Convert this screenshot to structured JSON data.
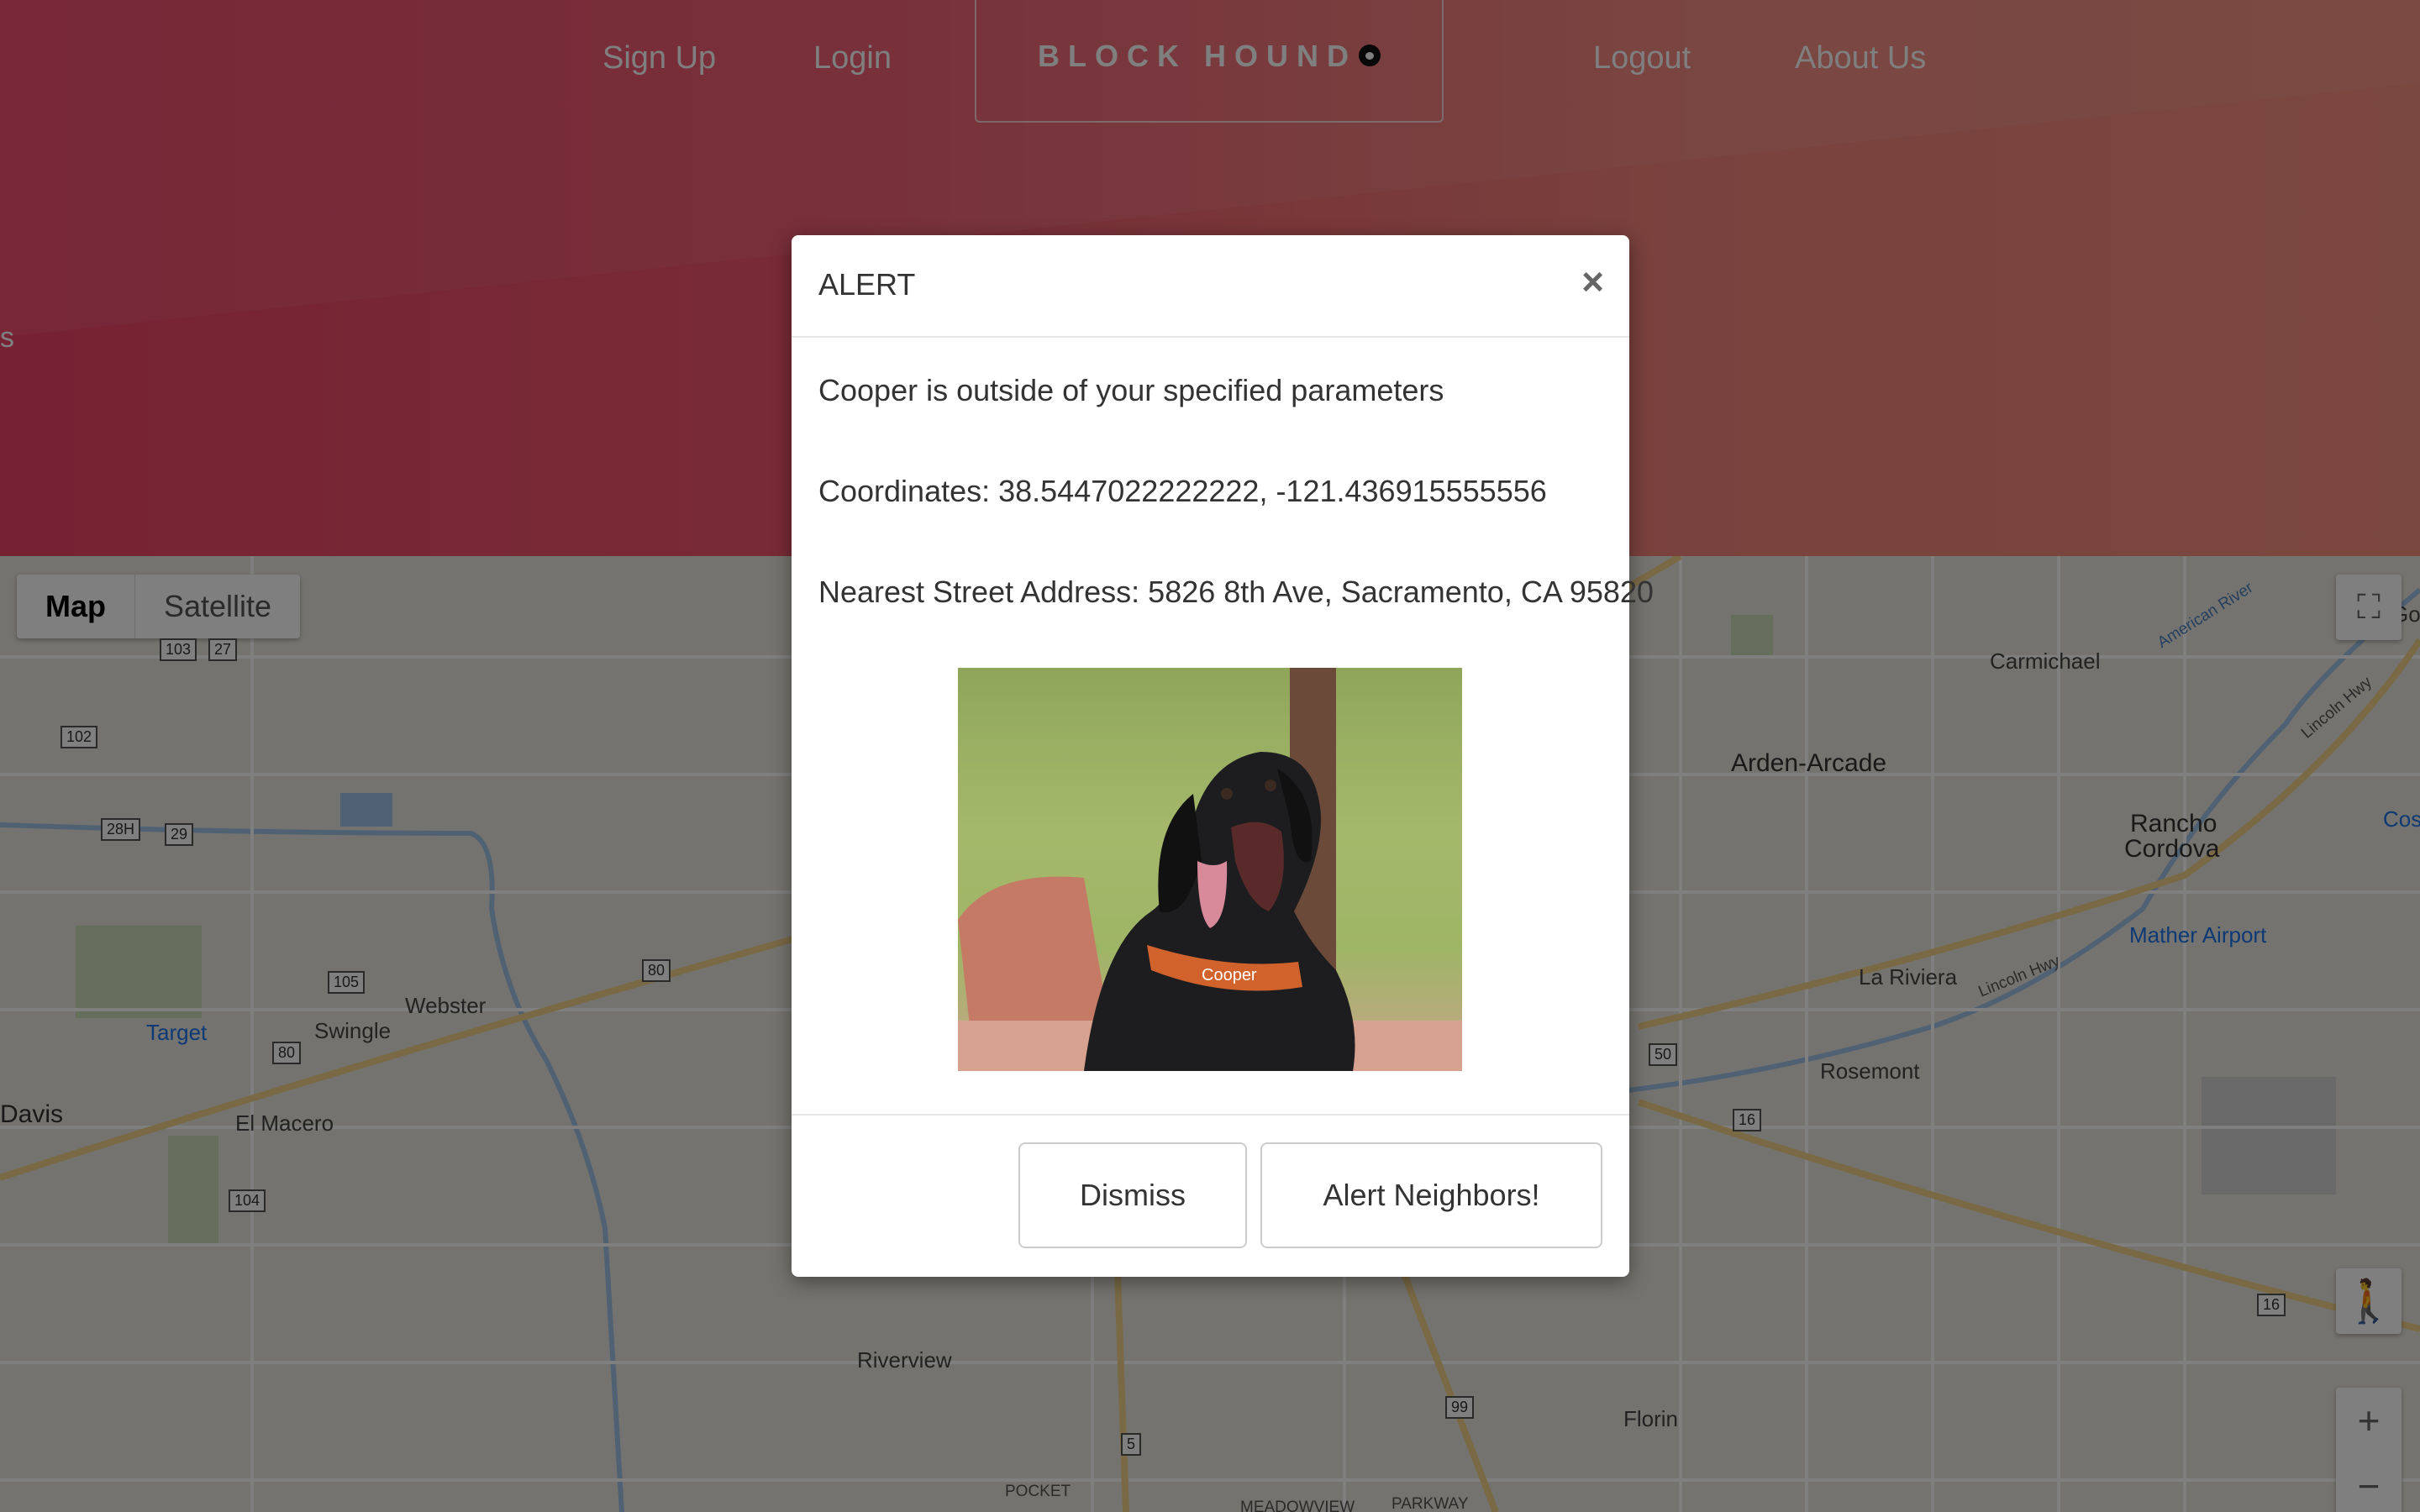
{
  "nav": {
    "signup": "Sign Up",
    "login": "Login",
    "brand": "BLOCK HOUND",
    "logout": "Logout",
    "about": "About Us"
  },
  "hero": {
    "edge_text": "s"
  },
  "map": {
    "type_buttons": [
      "Map",
      "Satellite"
    ],
    "selected_type": "Map",
    "controls": {
      "fullscreen_icon": "fullscreen-icon",
      "pegman_icon": "pegman-icon",
      "zoom_in": "+",
      "zoom_out": "−"
    },
    "places": {
      "carmichael": "Carmichael",
      "arden": "Arden-Arcade",
      "rancho": "Rancho",
      "cordova": "Cordova",
      "mather": "Mather Airport",
      "lariviera": "La Riviera",
      "rosemont": "Rosemont",
      "florin": "Florin",
      "riverview": "Riverview",
      "pocket": "POCKET",
      "meadowview": "MEADOWVIEW",
      "parkway": "PARKWAY",
      "target": "Target",
      "swingle": "Swingle",
      "webster": "Webster",
      "davis": "Davis",
      "elmacero": "El Macero",
      "american_river": "American River",
      "lincoln_hwy_1": "Lincoln Hwy",
      "lincoln_hwy_2": "Lincoln Hwy",
      "cos": "Cos",
      "go": "Go"
    },
    "shields": [
      "103",
      "27",
      "102",
      "28H",
      "29",
      "105",
      "80",
      "80",
      "104",
      "50",
      "16",
      "16",
      "99",
      "5"
    ]
  },
  "modal": {
    "title": "ALERT",
    "close": "×",
    "message": "Cooper is outside of your specified parameters",
    "coordinates": "Coordinates: 38.5447022222222, -121.436915555556",
    "address": "Nearest Street Address: 5826 8th Ave, Sacramento, CA 95820",
    "photo_alt": "Photo of Cooper",
    "collar_text": "Cooper",
    "dismiss": "Dismiss",
    "alert_neighbors": "Alert Neighbors!"
  }
}
